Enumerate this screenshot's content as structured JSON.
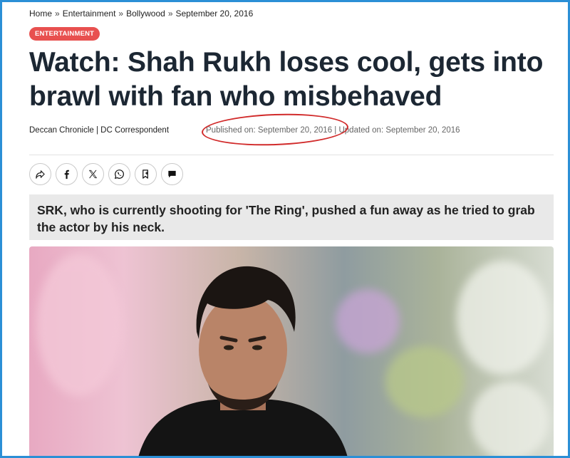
{
  "breadcrumb": {
    "items": [
      "Home",
      "Entertainment",
      "Bollywood",
      "September 20, 2016"
    ],
    "separator": "»"
  },
  "category_badge": "ENTERTAINMENT",
  "headline": "Watch: Shah Rukh loses cool, gets into brawl with fan who misbehaved",
  "byline": "Deccan Chronicle | DC Correspondent",
  "dates": "Published on: September 20, 2016 | Updated on: September 20, 2016",
  "share_icons": [
    "share-icon",
    "facebook-icon",
    "x-icon",
    "whatsapp-icon",
    "bookmark-icon",
    "comment-icon"
  ],
  "summary": "SRK, who is currently shooting for 'The Ring', pushed a fun away as he tried to grab the actor by his neck.",
  "colors": {
    "badge": "#e8504f",
    "headline": "#1c2733",
    "annotation_circle": "#d12a2a",
    "frame": "#2b8fd6",
    "summary_bg": "#e9e9e9"
  }
}
